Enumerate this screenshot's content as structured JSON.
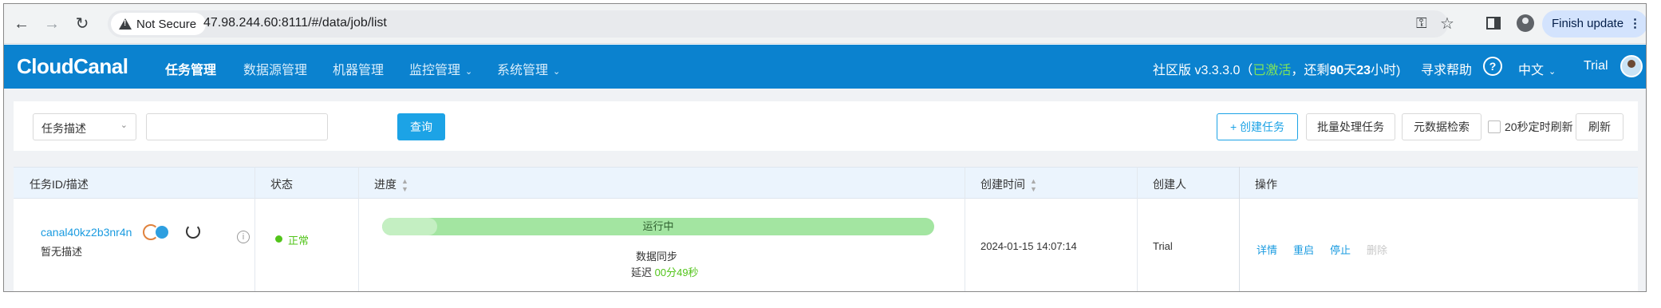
{
  "browser": {
    "security_label": "Not Secure",
    "url": "47.98.244.60:8111/#/data/job/list",
    "finish_update_label": "Finish update"
  },
  "header": {
    "logo": "CloudCanal",
    "menu": [
      {
        "label": "任务管理",
        "active": true,
        "dropdown": false
      },
      {
        "label": "数据源管理",
        "active": false,
        "dropdown": false
      },
      {
        "label": "机器管理",
        "active": false,
        "dropdown": false
      },
      {
        "label": "监控管理",
        "active": false,
        "dropdown": true
      },
      {
        "label": "系统管理",
        "active": false,
        "dropdown": true
      }
    ],
    "edition": "社区版 v3.3.3.0",
    "license_open": "（",
    "license_status": "已激活",
    "license_remaining_prefix": "，还剩",
    "license_days": "90",
    "license_day_unit": "天",
    "license_hours": "23",
    "license_hour_unit": "小时)",
    "help_label": "寻求帮助",
    "help_icon": "?",
    "language": "中文",
    "user": "Trial"
  },
  "toolbar": {
    "filter_select": "任务描述",
    "search_value": "",
    "query_label": "查询",
    "create_label": "+ 创建任务",
    "batch_label": "批量处理任务",
    "metadata_label": "元数据检索",
    "auto_refresh_label": "20秒定时刷新",
    "auto_refresh_checked": false,
    "refresh_label": "刷新"
  },
  "table": {
    "columns": {
      "id": "任务ID/描述",
      "status": "状态",
      "progress": "进度",
      "created_at": "创建时间",
      "creator": "创建人",
      "actions": "操作"
    },
    "rows": [
      {
        "task_id": "canal40kz2b3nr4n",
        "description": "暂无描述",
        "status": "正常",
        "progress_label": "运行中",
        "progress_fraction": 0.1,
        "stage": "数据同步",
        "latency_label": "延迟",
        "latency_value": "00分49秒",
        "created_at": "2024-01-15 14:07:14",
        "creator": "Trial",
        "actions": {
          "details": "详情",
          "restart": "重启",
          "stop": "停止",
          "delete": "删除"
        }
      }
    ]
  },
  "colors": {
    "header_bg": "#0b82cf",
    "accent": "#1ca3e6",
    "success": "#52c41a",
    "progress": "#a3e5a1"
  }
}
